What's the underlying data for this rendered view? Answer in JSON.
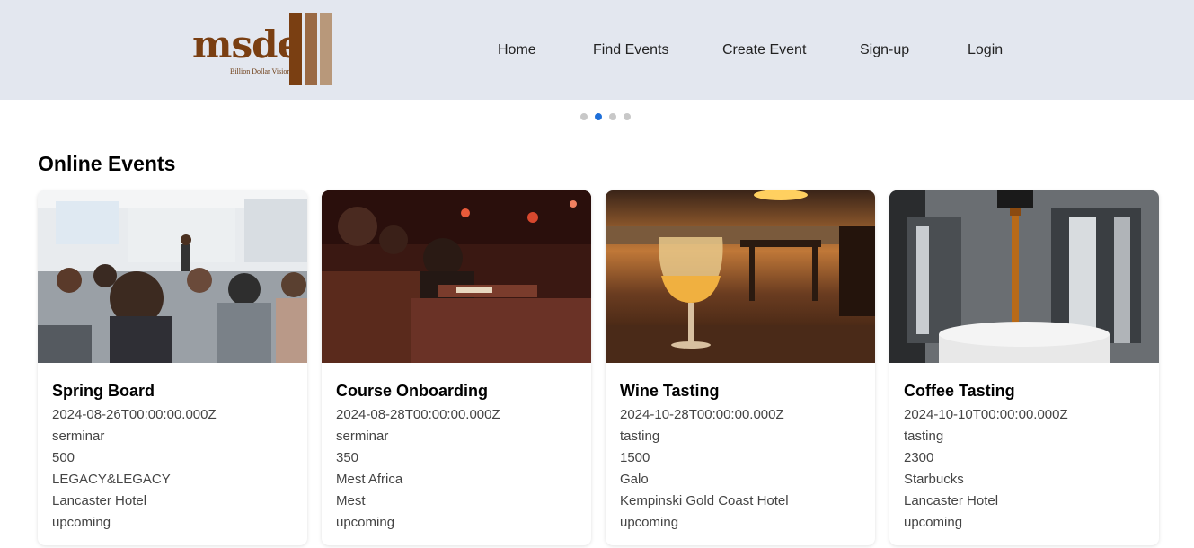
{
  "brand": {
    "logo_text": "msde",
    "tagline": "Billion Dollar Vision",
    "logo_colors": [
      "#7a3f12",
      "#9a6a45",
      "#b8987a"
    ]
  },
  "nav": {
    "items": [
      {
        "label": "Home"
      },
      {
        "label": "Find Events"
      },
      {
        "label": "Create Event"
      },
      {
        "label": "Sign-up"
      },
      {
        "label": "Login"
      }
    ]
  },
  "carousel": {
    "slide_count": 4,
    "active_index": 1,
    "active_color": "#1e6fd9"
  },
  "section": {
    "title": "Online Events"
  },
  "events": [
    {
      "title": "Spring Board",
      "date": "2024-08-26T00:00:00.000Z",
      "category": "serminar",
      "price": "500",
      "organizer": "LEGACY&LEGACY",
      "venue": "Lancaster Hotel",
      "status": "upcoming",
      "image_icon": "seminar-audience-photo"
    },
    {
      "title": "Course Onboarding",
      "date": "2024-08-28T00:00:00.000Z",
      "category": "serminar",
      "price": "350",
      "organizer": "Mest Africa",
      "venue": "Mest",
      "status": "upcoming",
      "image_icon": "lecture-hall-photo"
    },
    {
      "title": "Wine Tasting",
      "date": "2024-10-28T00:00:00.000Z",
      "category": "tasting",
      "price": "1500",
      "organizer": "Galo",
      "venue": "Kempinski Gold Coast Hotel",
      "status": "upcoming",
      "image_icon": "wine-glass-sunset-photo"
    },
    {
      "title": "Coffee Tasting",
      "date": "2024-10-10T00:00:00.000Z",
      "category": "tasting",
      "price": "2300",
      "organizer": "Starbucks",
      "venue": "Lancaster Hotel",
      "status": "upcoming",
      "image_icon": "espresso-machine-photo"
    }
  ]
}
